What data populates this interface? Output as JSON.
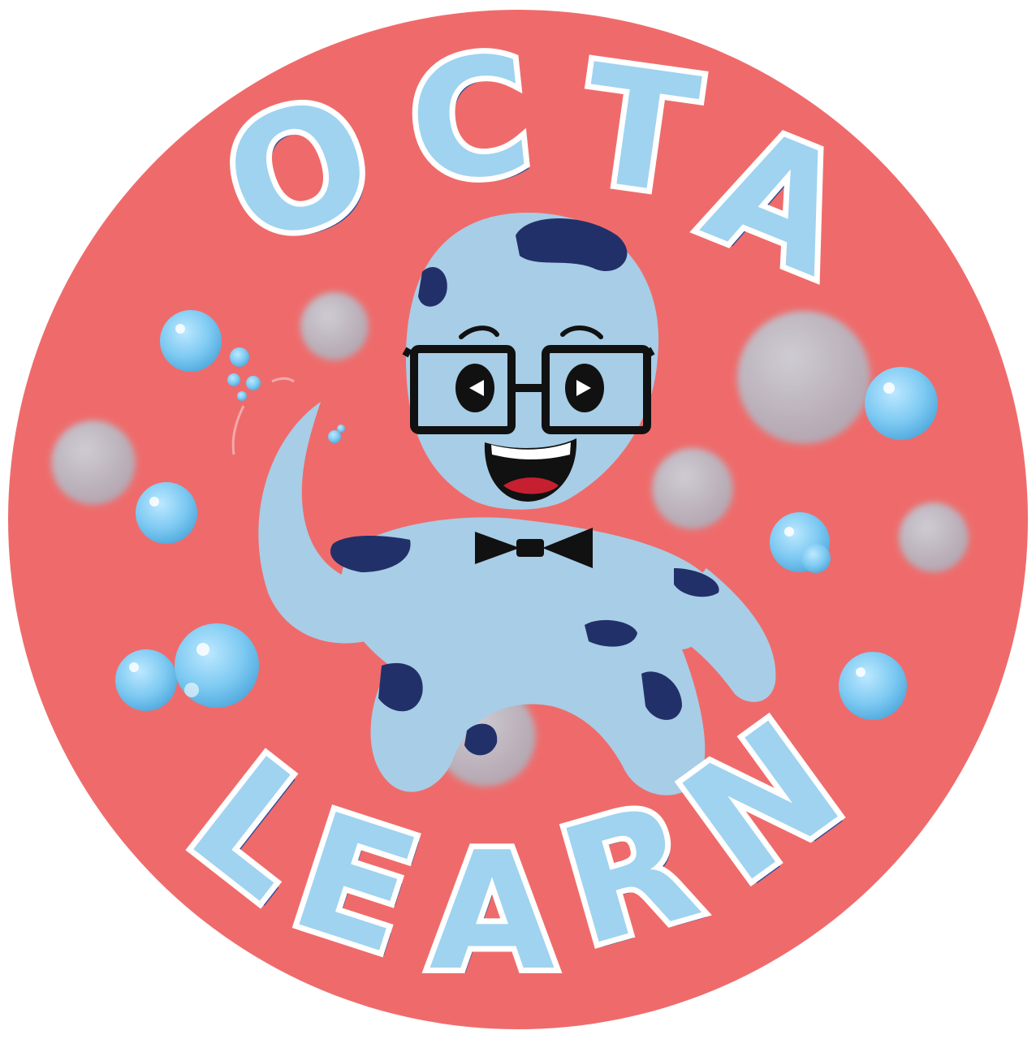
{
  "logo": {
    "word_top": [
      "O",
      "C",
      "T",
      "A"
    ],
    "word_bottom": [
      "L",
      "E",
      "A",
      "R",
      "N"
    ],
    "background_color": "#ef6b6b",
    "body_color": "#a8cde6",
    "spot_color": "#22306a",
    "letter_color": "#9fd3f0"
  }
}
